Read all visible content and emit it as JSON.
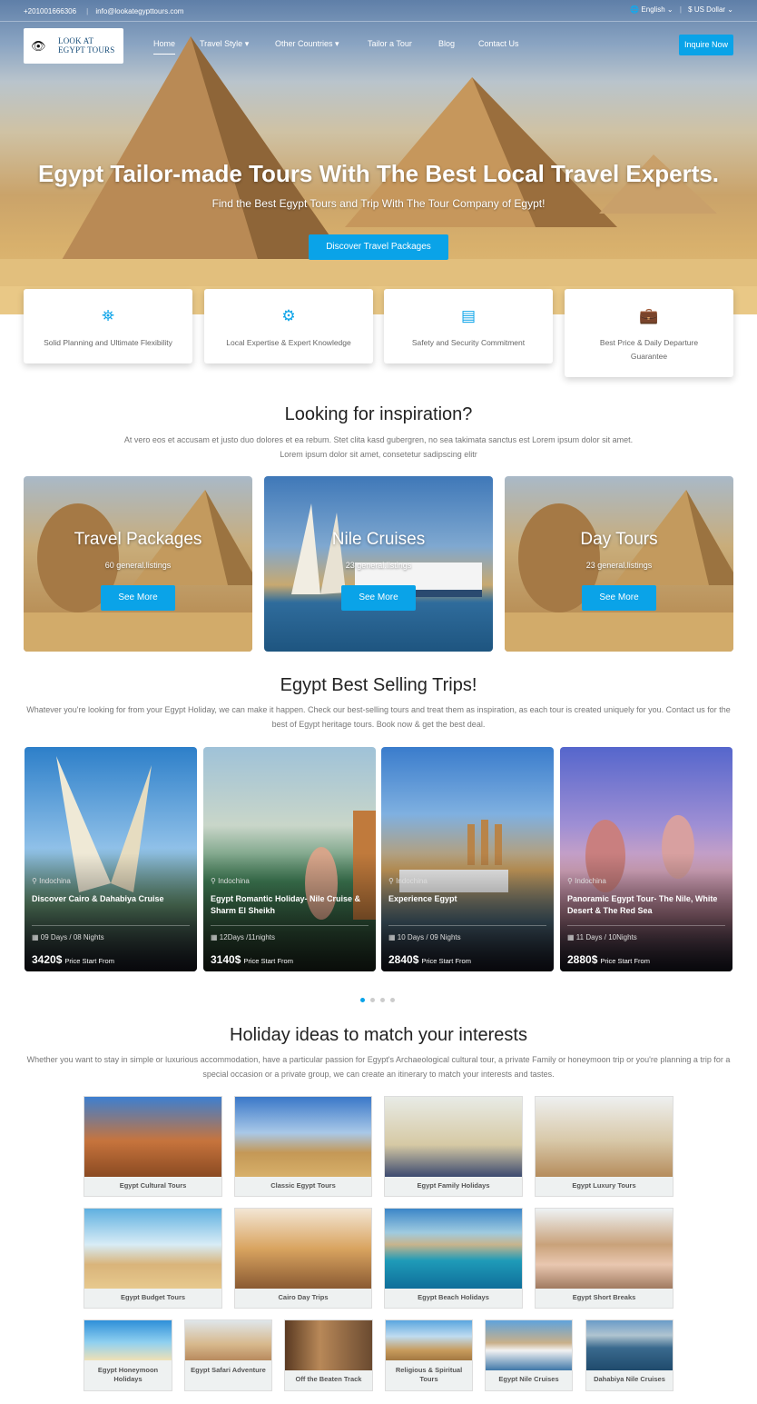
{
  "topbar": {
    "phone": "+201001666306",
    "email": "info@lookategypttours.com",
    "language": "English",
    "currency": "$ US Dollar"
  },
  "logo": {
    "line1": "LOOK AT",
    "line2": "EGYPT TOURS"
  },
  "nav": {
    "items": [
      "Home",
      "Travel Style",
      "Other Countries",
      "Tailor a Tour",
      "Blog",
      "Contact Us"
    ],
    "cta": "Inquire Now"
  },
  "hero": {
    "title": "Egypt Tailor-made Tours With The Best Local Travel Experts.",
    "subtitle": "Find the Best Egypt Tours and Trip With The Tour Company of Egypt!",
    "button": "Discover Travel Packages"
  },
  "features": [
    {
      "icon": "binoculars-icon",
      "text": "Solid Planning and Ultimate Flexibility"
    },
    {
      "icon": "gear-icon",
      "text": "Local Expertise & Expert Knowledge"
    },
    {
      "icon": "book-icon",
      "text": "Safety and Security Commitment"
    },
    {
      "icon": "briefcase-icon",
      "text": "Best Price & Daily Departure Guarantee"
    }
  ],
  "inspiration": {
    "title": "Looking for inspiration?",
    "text": "At vero eos et accusam et justo duo dolores et ea rebum. Stet clita kasd gubergren, no sea takimata sanctus est Lorem ipsum dolor sit amet. Lorem ipsum dolor sit amet, consetetur sadipscing elitr"
  },
  "categories": [
    {
      "title": "Travel Packages",
      "count": "60 general.listings",
      "button": "See More"
    },
    {
      "title": "Nile Cruises",
      "count": "23 general.listings",
      "button": "See More"
    },
    {
      "title": "Day Tours",
      "count": "23 general.listings",
      "button": "See More"
    }
  ],
  "bestselling": {
    "title": "Egypt Best Selling Trips!",
    "text": "Whatever you're looking for from your Egypt Holiday, we can make it happen. Check our best-selling tours and treat them as inspiration, as each tour is created uniquely for you. Contact us for the best of Egypt heritage tours. Book now & get the best deal."
  },
  "trips": [
    {
      "location": "Indochina",
      "name": "Discover Cairo & Dahabiya Cruise",
      "duration": "09 Days / 08 Nights",
      "price": "3420$",
      "price_label": "Price Start From"
    },
    {
      "location": "Indochina",
      "name": "Egypt Romantic Holiday- Nile Cruise & Sharm El Sheikh",
      "duration": "12Days /11nights",
      "price": "3140$",
      "price_label": "Price Start From"
    },
    {
      "location": "Indochina",
      "name": "Experience Egypt",
      "duration": "10 Days / 09 Nights",
      "price": "2840$",
      "price_label": "Price Start From"
    },
    {
      "location": "Indochina",
      "name": "Panoramic Egypt Tour- The Nile, White Desert & The Red Sea",
      "duration": "11 Days / 10Nights",
      "price": "2880$",
      "price_label": "Price Start From"
    }
  ],
  "interests": {
    "title": "Holiday ideas to match your interests",
    "text": "Whether you want to stay in simple or luxurious accommodation, have a particular passion for Egypt's Archaeological cultural tour, a private Family or honeymoon trip or you're planning a trip for a special occasion or a private group, we can create an itinerary to match your interests and tastes.",
    "row1": [
      "Egypt Cultural Tours",
      "Classic Egypt Tours",
      "Egypt Family Holidays",
      "Egypt Luxury Tours"
    ],
    "row2": [
      "Egypt Budget Tours",
      "Cairo Day Trips",
      "Egypt Beach Holidays",
      "Egypt Short Breaks"
    ],
    "row3": [
      "Egypt Honeymoon Holidays",
      "Egypt Safari Adventure",
      "Off the Beaten Track",
      "Religious & Spiritual Tours",
      "Egypt Nile Cruises",
      "Dahabiya Nile Cruises"
    ]
  }
}
